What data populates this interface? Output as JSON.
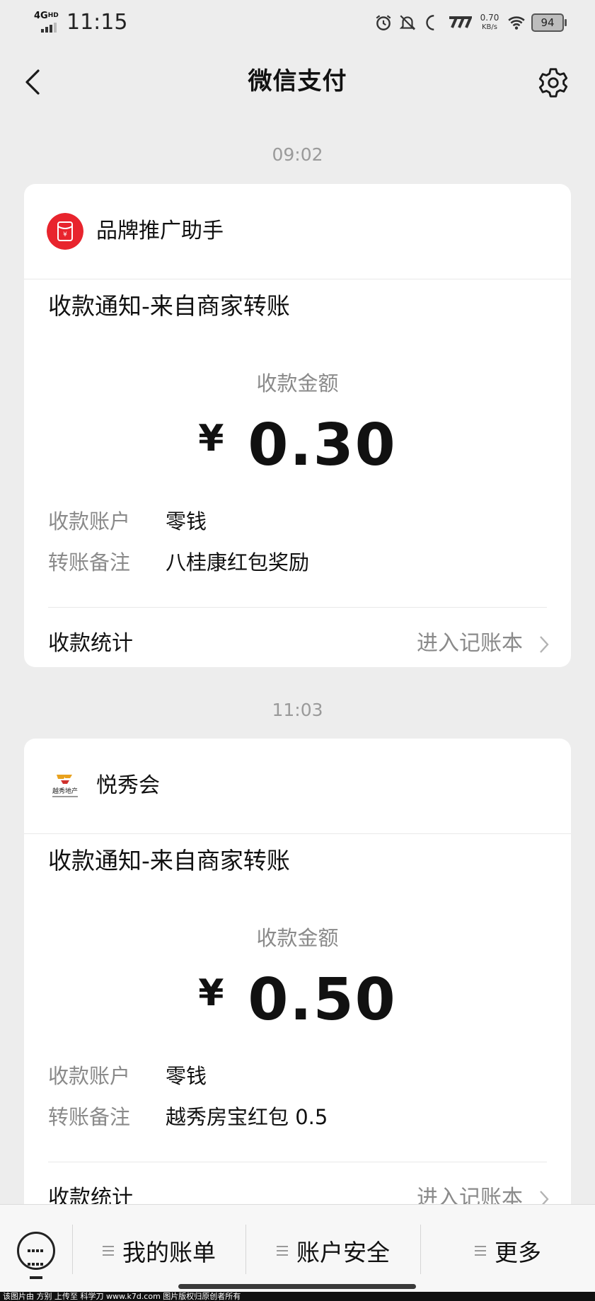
{
  "status_bar": {
    "network": "4G",
    "network_sup": "HD",
    "time": "11:15",
    "speed_value": "0.70",
    "speed_unit": "KB/s",
    "battery": "94"
  },
  "nav": {
    "title": "微信支付"
  },
  "messages": [
    {
      "time": "09:02",
      "merchant": "品牌推广助手",
      "notice_title": "收款通知-来自商家转账",
      "amount_label": "收款金额",
      "currency": "¥",
      "amount": "0.30",
      "account_key": "收款账户",
      "account_value": "零钱",
      "remark_key": "转账备注",
      "remark_value": "八桂康红包奖励",
      "stats_label": "收款统计",
      "stats_link": "进入记账本"
    },
    {
      "time": "11:03",
      "merchant": "悦秀会",
      "merchant_logo_text": "越秀地产",
      "notice_title": "收款通知-来自商家转账",
      "amount_label": "收款金额",
      "currency": "¥",
      "amount": "0.50",
      "account_key": "收款账户",
      "account_value": "零钱",
      "remark_key": "转账备注",
      "remark_value": "越秀房宝红包 0.5",
      "stats_label": "收款统计",
      "stats_link": "进入记账本"
    }
  ],
  "bottom_bar": {
    "items": [
      "我的账单",
      "账户安全",
      "更多"
    ]
  },
  "footer": {
    "text": "该图片由 方别 上传至 科学刀 www.k7d.com 图片版权归原创者所有"
  },
  "colors": {
    "background": "#ededed",
    "card": "#ffffff",
    "red_packet": "#e8242d",
    "muted_text": "#8a8a8a"
  }
}
